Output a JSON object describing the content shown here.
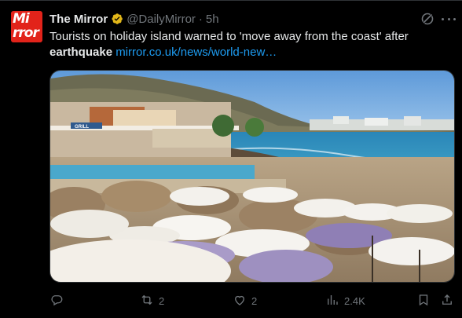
{
  "tweet": {
    "name": "The Mirror",
    "handle": "@DailyMirror",
    "separator": "·",
    "time": "5h",
    "avatar_top": "Mi",
    "avatar_bottom": "rror",
    "text_main": "Tourists on holiday island warned to 'move away from the coast' after ",
    "text_bold": "earthquake",
    "link": "mirror.co.uk/news/world-new…",
    "image_sign": "GRILL"
  },
  "actions": {
    "reply_count": "",
    "retweet_count": "2",
    "like_count": "2",
    "views_count": "2.4K"
  },
  "icons": {
    "verified": "verified-badge-icon",
    "grok": "grok-icon",
    "more": "more-icon",
    "reply": "reply-icon",
    "retweet": "retweet-icon",
    "like": "heart-icon",
    "views": "views-icon",
    "bookmark": "bookmark-icon",
    "share": "share-icon"
  },
  "colors": {
    "background": "#000000",
    "text": "#e7e9ea",
    "muted": "#71767b",
    "link": "#1d9bf0",
    "verified_gold": "#e2b719",
    "brand_red": "#e2231a"
  }
}
